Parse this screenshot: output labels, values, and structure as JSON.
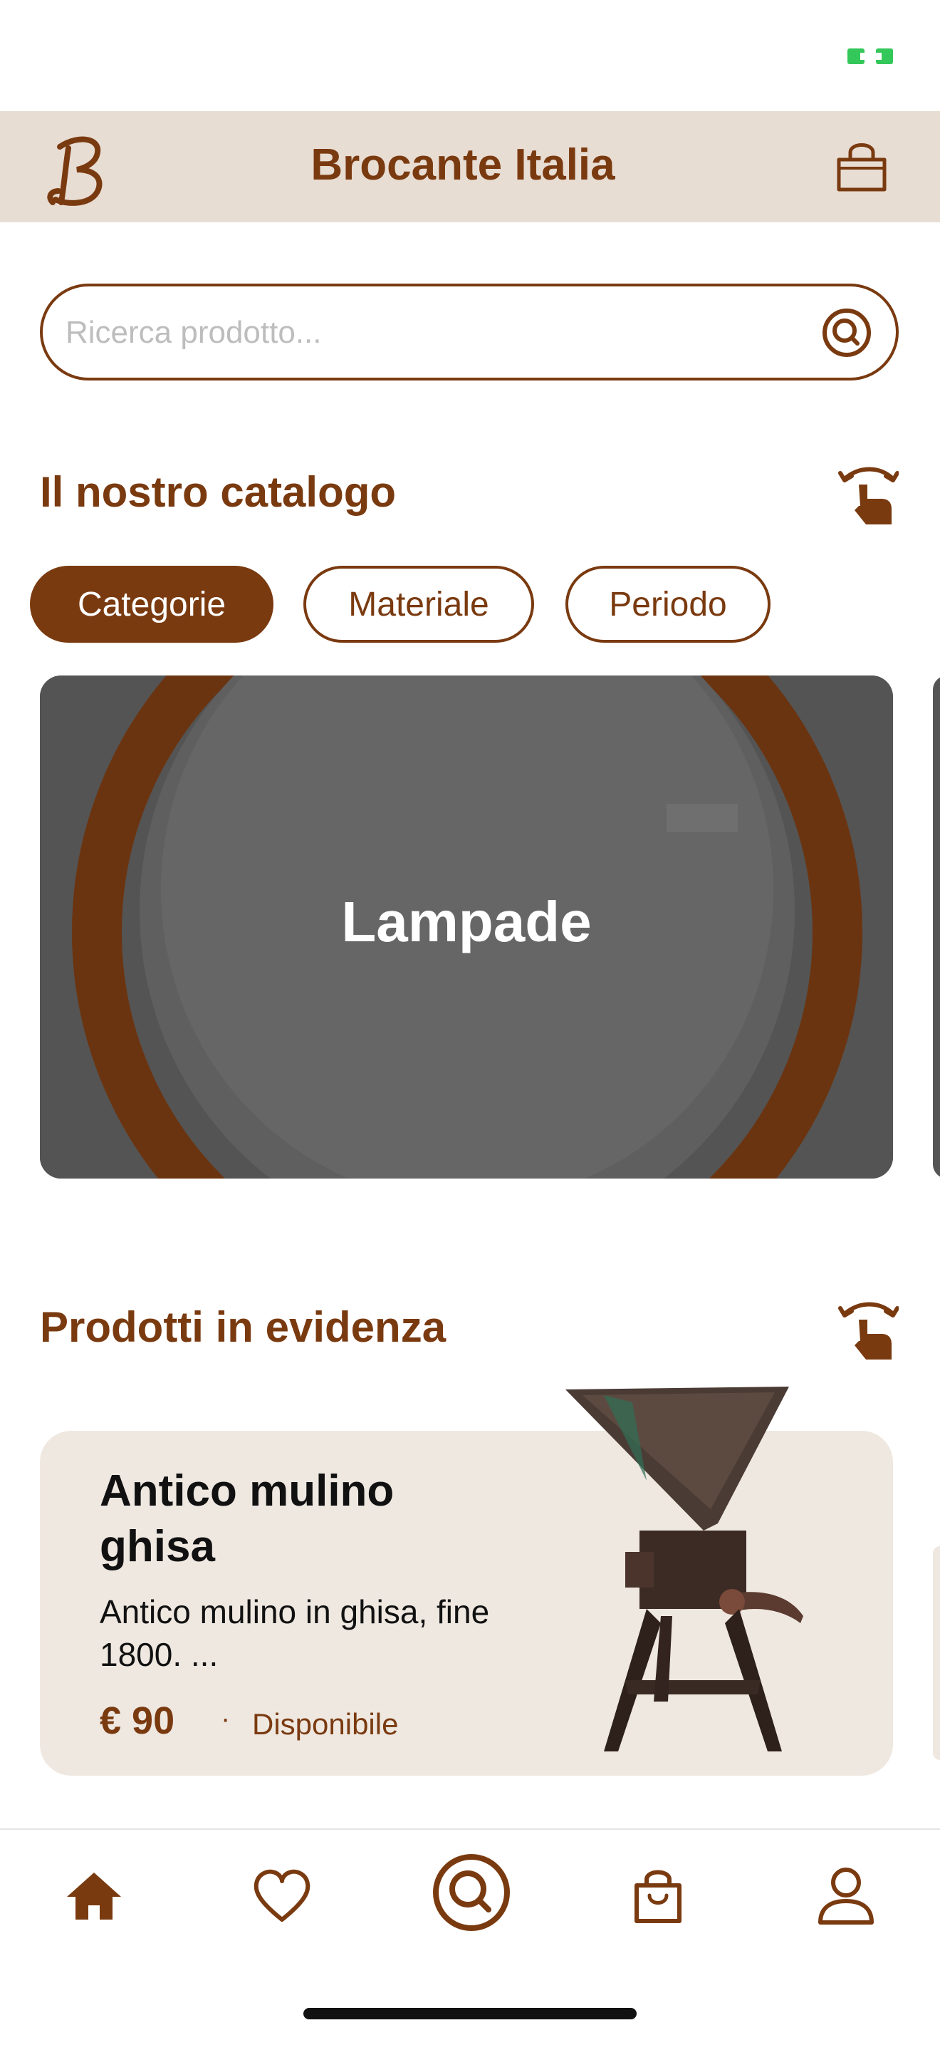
{
  "header": {
    "title": "Brocante Italia",
    "logo_letter": "B"
  },
  "search": {
    "placeholder": "Ricerca prodotto...",
    "value": ""
  },
  "catalog": {
    "title": "Il nostro catalogo",
    "chips": [
      {
        "label": "Categorie",
        "active": true
      },
      {
        "label": "Materiale",
        "active": false
      },
      {
        "label": "Periodo",
        "active": false
      }
    ],
    "card_label": "Lampade"
  },
  "featured": {
    "title": "Prodotti in evidenza",
    "product": {
      "name": "Antico mulino ghisa",
      "description": "Antico mulino in ghisa, fine 1800. ...",
      "price": "€ 90",
      "separator": "·",
      "availability": "Disponibile"
    }
  },
  "tabs": [
    {
      "icon": "home-icon",
      "active": true
    },
    {
      "icon": "heart-icon",
      "active": false
    },
    {
      "icon": "search-icon",
      "active": false
    },
    {
      "icon": "shopping-bag-icon",
      "active": false
    },
    {
      "icon": "user-icon",
      "active": false
    }
  ],
  "colors": {
    "brand": "#7a3a10",
    "header_bg": "#e8ddd3",
    "card_bg": "#efe8e1",
    "battery": "#34c759"
  }
}
